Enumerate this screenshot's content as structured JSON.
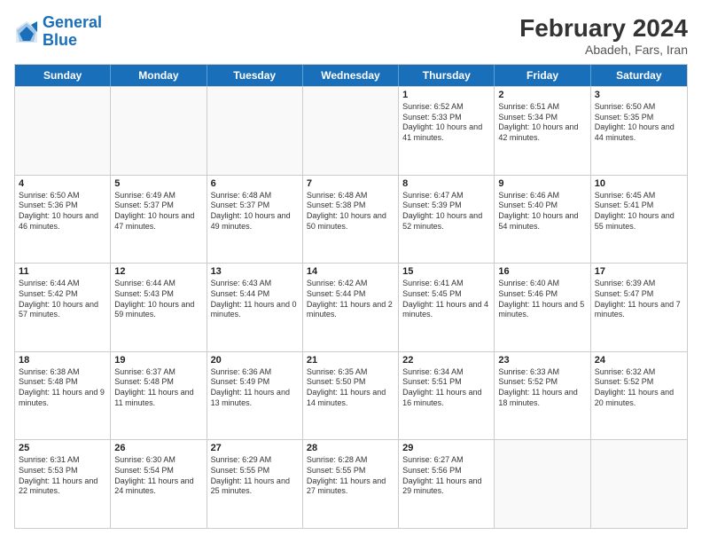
{
  "logo": {
    "line1": "General",
    "line2": "Blue"
  },
  "title": {
    "month_year": "February 2024",
    "location": "Abadeh, Fars, Iran"
  },
  "days_of_week": [
    "Sunday",
    "Monday",
    "Tuesday",
    "Wednesday",
    "Thursday",
    "Friday",
    "Saturday"
  ],
  "weeks": [
    [
      {
        "day": "",
        "text": "",
        "empty": true
      },
      {
        "day": "",
        "text": "",
        "empty": true
      },
      {
        "day": "",
        "text": "",
        "empty": true
      },
      {
        "day": "",
        "text": "",
        "empty": true
      },
      {
        "day": "1",
        "text": "Sunrise: 6:52 AM\nSunset: 5:33 PM\nDaylight: 10 hours and 41 minutes."
      },
      {
        "day": "2",
        "text": "Sunrise: 6:51 AM\nSunset: 5:34 PM\nDaylight: 10 hours and 42 minutes."
      },
      {
        "day": "3",
        "text": "Sunrise: 6:50 AM\nSunset: 5:35 PM\nDaylight: 10 hours and 44 minutes."
      }
    ],
    [
      {
        "day": "4",
        "text": "Sunrise: 6:50 AM\nSunset: 5:36 PM\nDaylight: 10 hours and 46 minutes."
      },
      {
        "day": "5",
        "text": "Sunrise: 6:49 AM\nSunset: 5:37 PM\nDaylight: 10 hours and 47 minutes."
      },
      {
        "day": "6",
        "text": "Sunrise: 6:48 AM\nSunset: 5:37 PM\nDaylight: 10 hours and 49 minutes."
      },
      {
        "day": "7",
        "text": "Sunrise: 6:48 AM\nSunset: 5:38 PM\nDaylight: 10 hours and 50 minutes."
      },
      {
        "day": "8",
        "text": "Sunrise: 6:47 AM\nSunset: 5:39 PM\nDaylight: 10 hours and 52 minutes."
      },
      {
        "day": "9",
        "text": "Sunrise: 6:46 AM\nSunset: 5:40 PM\nDaylight: 10 hours and 54 minutes."
      },
      {
        "day": "10",
        "text": "Sunrise: 6:45 AM\nSunset: 5:41 PM\nDaylight: 10 hours and 55 minutes."
      }
    ],
    [
      {
        "day": "11",
        "text": "Sunrise: 6:44 AM\nSunset: 5:42 PM\nDaylight: 10 hours and 57 minutes."
      },
      {
        "day": "12",
        "text": "Sunrise: 6:44 AM\nSunset: 5:43 PM\nDaylight: 10 hours and 59 minutes."
      },
      {
        "day": "13",
        "text": "Sunrise: 6:43 AM\nSunset: 5:44 PM\nDaylight: 11 hours and 0 minutes."
      },
      {
        "day": "14",
        "text": "Sunrise: 6:42 AM\nSunset: 5:44 PM\nDaylight: 11 hours and 2 minutes."
      },
      {
        "day": "15",
        "text": "Sunrise: 6:41 AM\nSunset: 5:45 PM\nDaylight: 11 hours and 4 minutes."
      },
      {
        "day": "16",
        "text": "Sunrise: 6:40 AM\nSunset: 5:46 PM\nDaylight: 11 hours and 5 minutes."
      },
      {
        "day": "17",
        "text": "Sunrise: 6:39 AM\nSunset: 5:47 PM\nDaylight: 11 hours and 7 minutes."
      }
    ],
    [
      {
        "day": "18",
        "text": "Sunrise: 6:38 AM\nSunset: 5:48 PM\nDaylight: 11 hours and 9 minutes."
      },
      {
        "day": "19",
        "text": "Sunrise: 6:37 AM\nSunset: 5:48 PM\nDaylight: 11 hours and 11 minutes."
      },
      {
        "day": "20",
        "text": "Sunrise: 6:36 AM\nSunset: 5:49 PM\nDaylight: 11 hours and 13 minutes."
      },
      {
        "day": "21",
        "text": "Sunrise: 6:35 AM\nSunset: 5:50 PM\nDaylight: 11 hours and 14 minutes."
      },
      {
        "day": "22",
        "text": "Sunrise: 6:34 AM\nSunset: 5:51 PM\nDaylight: 11 hours and 16 minutes."
      },
      {
        "day": "23",
        "text": "Sunrise: 6:33 AM\nSunset: 5:52 PM\nDaylight: 11 hours and 18 minutes."
      },
      {
        "day": "24",
        "text": "Sunrise: 6:32 AM\nSunset: 5:52 PM\nDaylight: 11 hours and 20 minutes."
      }
    ],
    [
      {
        "day": "25",
        "text": "Sunrise: 6:31 AM\nSunset: 5:53 PM\nDaylight: 11 hours and 22 minutes."
      },
      {
        "day": "26",
        "text": "Sunrise: 6:30 AM\nSunset: 5:54 PM\nDaylight: 11 hours and 24 minutes."
      },
      {
        "day": "27",
        "text": "Sunrise: 6:29 AM\nSunset: 5:55 PM\nDaylight: 11 hours and 25 minutes."
      },
      {
        "day": "28",
        "text": "Sunrise: 6:28 AM\nSunset: 5:55 PM\nDaylight: 11 hours and 27 minutes."
      },
      {
        "day": "29",
        "text": "Sunrise: 6:27 AM\nSunset: 5:56 PM\nDaylight: 11 hours and 29 minutes."
      },
      {
        "day": "",
        "text": "",
        "empty": true
      },
      {
        "day": "",
        "text": "",
        "empty": true
      }
    ]
  ]
}
